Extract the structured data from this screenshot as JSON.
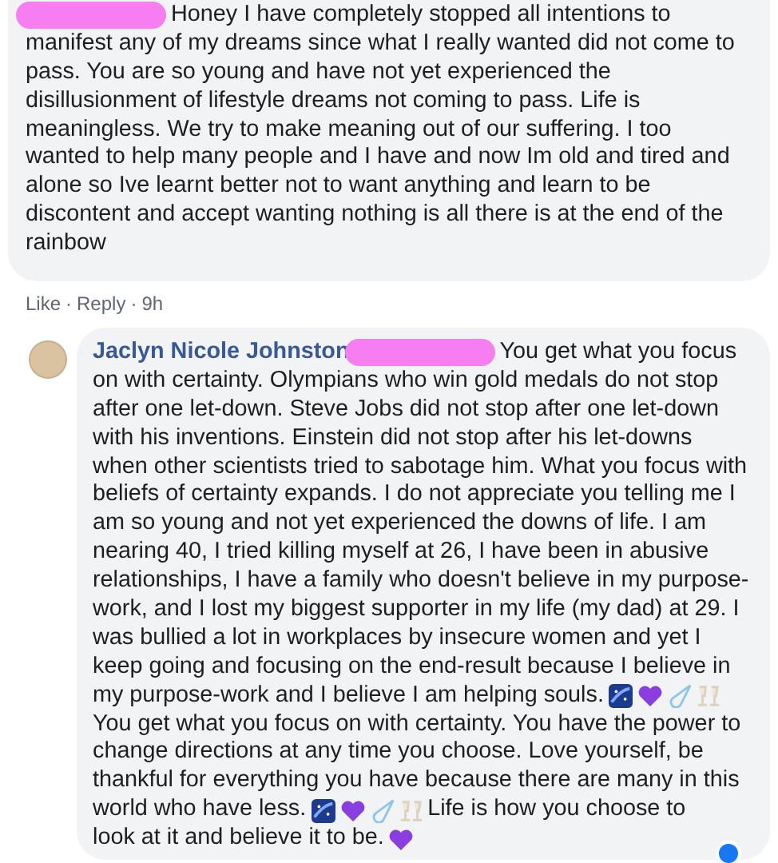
{
  "comments": [
    {
      "redacted": true,
      "lines": [
        [
          {
            "kind": "text",
            "text": "Honey I have completely stopped all intentions to"
          }
        ],
        [
          {
            "kind": "text",
            "text": "manifest any of my dreams since what I really wanted did not come to"
          }
        ],
        [
          {
            "kind": "text",
            "text": "pass. You are so young and have not yet experienced the"
          }
        ],
        [
          {
            "kind": "text",
            "text": "disillusionment of lifestyle dreams not coming to pass. Life is"
          }
        ],
        [
          {
            "kind": "text",
            "text": "meaningless. We try to make meaning out of our suffering. I too"
          }
        ],
        [
          {
            "kind": "text",
            "text": "wanted to help many people and I have and now Im old and tired and"
          }
        ],
        [
          {
            "kind": "text",
            "text": "alone so Ive learnt better not to want anything and learn to be"
          }
        ],
        [
          {
            "kind": "text",
            "text": "discontent and accept wanting nothing is all there is at the end of the"
          }
        ],
        [
          {
            "kind": "text",
            "text": "rainbow"
          }
        ]
      ],
      "footer": [
        "Like",
        "·",
        "Reply",
        "·",
        "9h"
      ]
    },
    {
      "author": "Jaclyn Nicole Johnston",
      "redacted": true,
      "reaction": true,
      "lines": [
        [
          {
            "kind": "text",
            "text": "You get what you focus"
          }
        ],
        [
          {
            "kind": "text",
            "text": "on with certainty. Olympians who win gold medals do not stop"
          }
        ],
        [
          {
            "kind": "text",
            "text": "after one let-down. Steve Jobs did not stop after one let-down"
          }
        ],
        [
          {
            "kind": "text",
            "text": "with his inventions. Einstein did not stop after his let-downs"
          }
        ],
        [
          {
            "kind": "text",
            "text": "when other scientists tried to sabotage him. What you focus with"
          }
        ],
        [
          {
            "kind": "text",
            "text": "beliefs of certainty expands. I do not appreciate you telling me I"
          }
        ],
        [
          {
            "kind": "text",
            "text": "am so young and not yet experienced the downs of life. I am"
          }
        ],
        [
          {
            "kind": "text",
            "text": "nearing 40, I tried killing myself at 26, I have been in abusive"
          }
        ],
        [
          {
            "kind": "text",
            "text": "relationships, I have a family who doesn't believe in my purpose-"
          }
        ],
        [
          {
            "kind": "text",
            "text": "work, and I lost my biggest supporter in my life (my dad) at 29. I"
          }
        ],
        [
          {
            "kind": "text",
            "text": "was bullied a lot in workplaces by insecure women and yet I"
          }
        ],
        [
          {
            "kind": "text",
            "text": "keep going and focusing on the end-result because I believe in"
          }
        ],
        [
          {
            "kind": "text",
            "text": "my purpose-work and I believe I am helping souls."
          },
          {
            "kind": "galaxy"
          },
          {
            "kind": "heart"
          },
          {
            "kind": "comet"
          },
          {
            "kind": "glasses"
          }
        ],
        [
          {
            "kind": "text",
            "text": "You get what you focus on with certainty. You have the power to"
          }
        ],
        [
          {
            "kind": "text",
            "text": "change directions at any time you choose. Love yourself, be"
          }
        ],
        [
          {
            "kind": "text",
            "text": "thankful for everything you have because there are many in this"
          }
        ],
        [
          {
            "kind": "text",
            "text": "world who have less."
          },
          {
            "kind": "galaxy"
          },
          {
            "kind": "heart"
          },
          {
            "kind": "comet"
          },
          {
            "kind": "glasses"
          },
          {
            "kind": "text",
            "text": "Life is how you choose to"
          }
        ],
        [
          {
            "kind": "text",
            "text": "look at it and believe it to be."
          },
          {
            "kind": "heart"
          }
        ]
      ]
    }
  ]
}
